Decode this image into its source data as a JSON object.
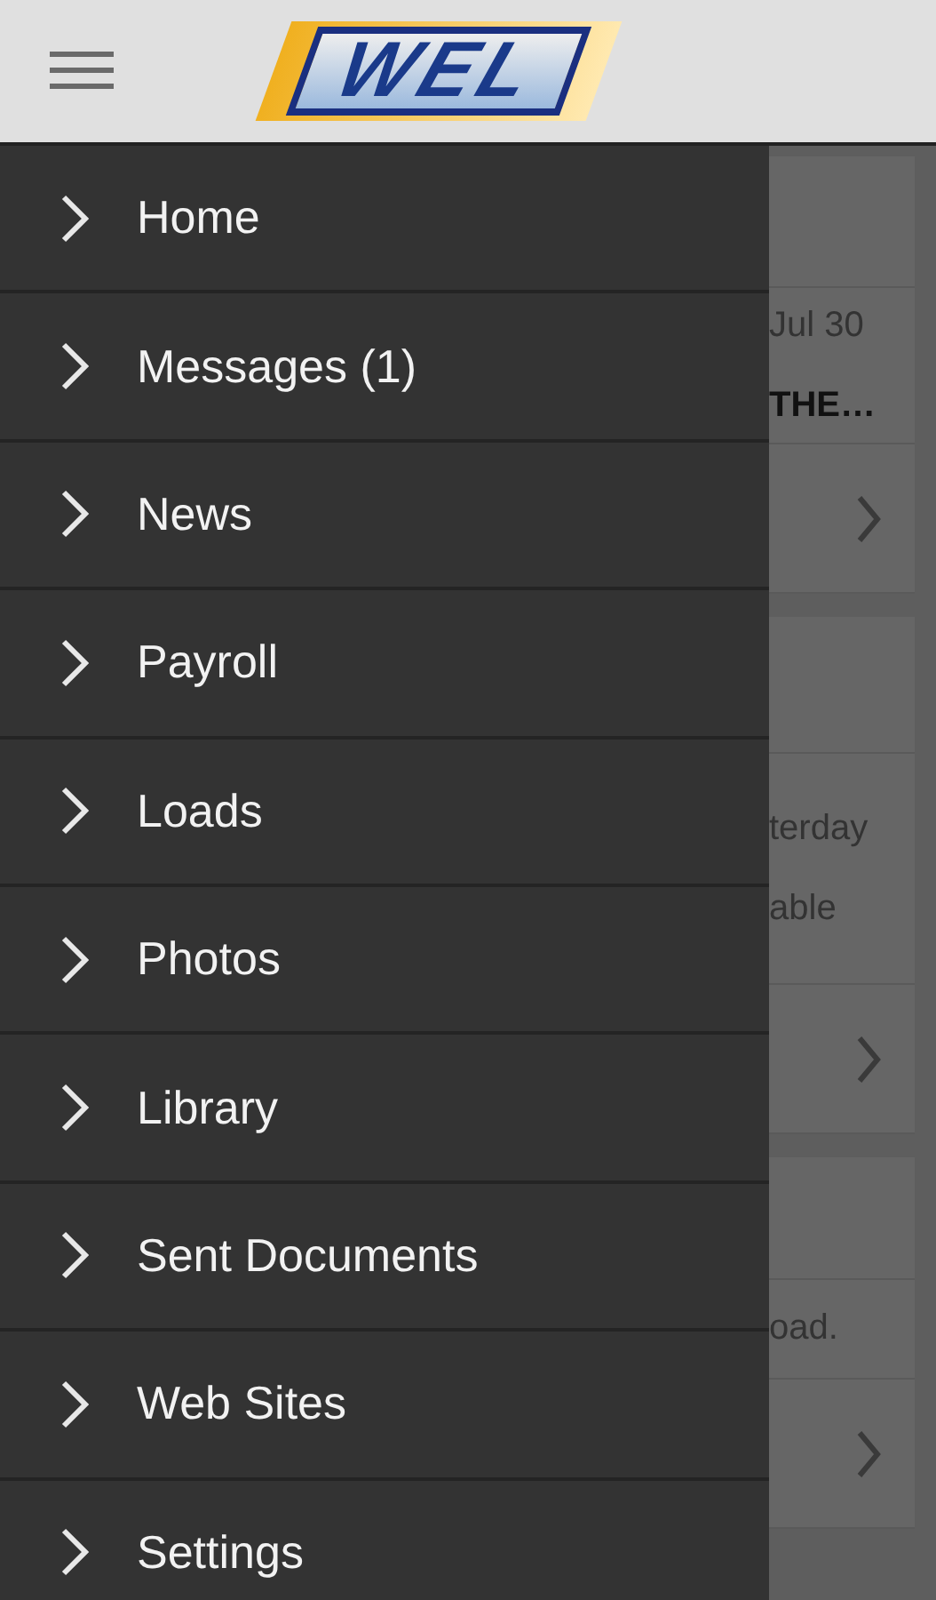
{
  "header": {
    "logo": "WEL"
  },
  "menu": [
    {
      "label": "Home"
    },
    {
      "label": "Messages (1)"
    },
    {
      "label": "News"
    },
    {
      "label": "Payroll"
    },
    {
      "label": "Loads"
    },
    {
      "label": "Photos"
    },
    {
      "label": "Library"
    },
    {
      "label": "Sent Documents"
    },
    {
      "label": "Web Sites"
    },
    {
      "label": "Settings"
    }
  ],
  "cards": [
    {
      "lines": [
        {
          "text": "Jul 30",
          "bold": false
        },
        {
          "text": "THE…",
          "bold": true
        }
      ]
    },
    {
      "lines": [
        {
          "text": "terday",
          "bold": false
        },
        {
          "text": "able",
          "bold": false
        }
      ]
    },
    {
      "lines": [
        {
          "text": "oad.",
          "bold": false
        }
      ]
    }
  ]
}
